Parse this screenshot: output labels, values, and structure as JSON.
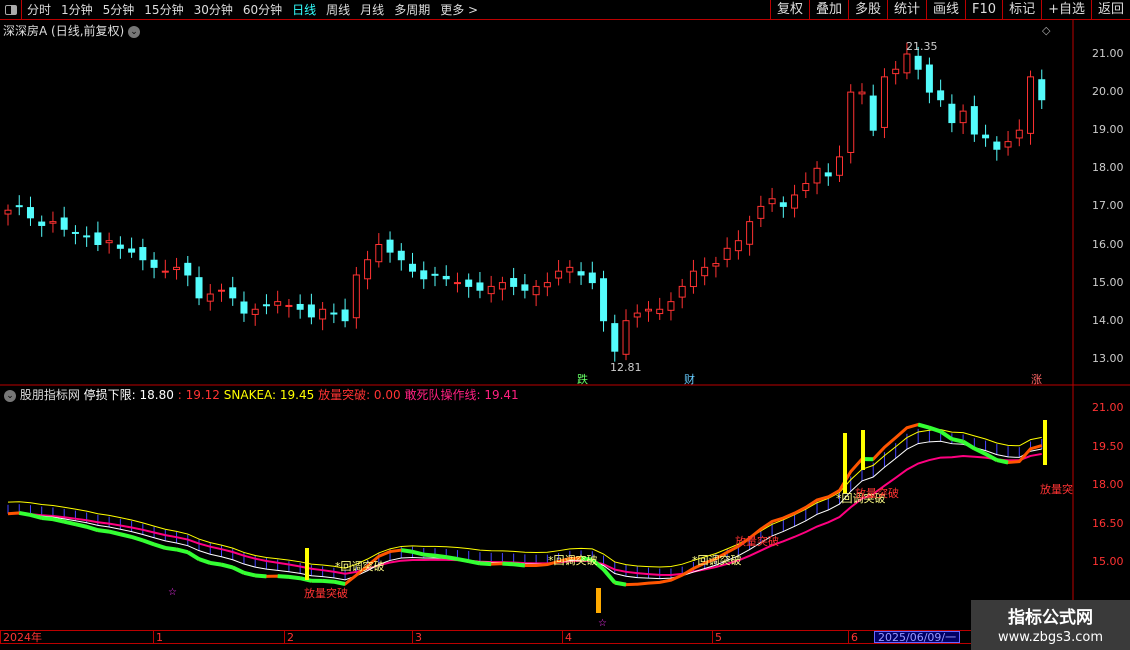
{
  "toolbar": {
    "periods": [
      "分时",
      "1分钟",
      "5分钟",
      "15分钟",
      "30分钟",
      "60分钟",
      "日线",
      "周线",
      "月线",
      "多周期",
      "更多 >"
    ],
    "active": "日线",
    "right_buttons": [
      "复权",
      "叠加",
      "多股",
      "统计",
      "画线",
      "F10",
      "标记",
      "+自选",
      "返回"
    ]
  },
  "main_title": "深深房A (日线,前复权)",
  "price_axis": [
    "21.00",
    "20.00",
    "19.00",
    "18.00",
    "17.00",
    "16.00",
    "15.00",
    "14.00",
    "13.00"
  ],
  "annotations": {
    "high": "21.35",
    "low": "12.81",
    "tag_die": "跌",
    "tag_cai": "财",
    "tag_zhang": "涨"
  },
  "indicator": {
    "name": "股朋指标网",
    "stop_label": "停损下限: 18.80",
    "v2": ": 19.12",
    "snake": "SNAKEA: 19.45",
    "vol_break": "放量突破: 0.00",
    "dare": "敢死队操作线: 19.41",
    "axis": [
      "21.00",
      "19.50",
      "18.00",
      "16.50",
      "15.00"
    ],
    "labels": {
      "huitiao": "*回调突破",
      "fangliang": "放量突破",
      "fangliang_cut": "放量突"
    }
  },
  "time_axis": {
    "year": "2024年",
    "months": [
      "1",
      "2",
      "3",
      "4",
      "5",
      "6"
    ],
    "cursor_date": "2025/06/09/一"
  },
  "watermark": {
    "title": "指标公式网",
    "url": "www.zbgs3.com"
  },
  "colors": {
    "up": "#ff3232",
    "down": "#54fcfc",
    "snake": "#ffff00",
    "dare": "#ff0080"
  },
  "chart_data": {
    "type": "candlestick",
    "closes": [
      16.9,
      17.0,
      16.7,
      16.5,
      16.6,
      16.4,
      16.3,
      16.2,
      16.0,
      16.1,
      15.9,
      15.8,
      15.6,
      15.4,
      15.3,
      15.4,
      15.2,
      14.6,
      14.7,
      14.8,
      14.6,
      14.2,
      14.3,
      14.4,
      14.5,
      14.4,
      14.3,
      14.1,
      14.3,
      14.2,
      14.0,
      15.2,
      15.6,
      16.0,
      15.8,
      15.6,
      15.3,
      15.1,
      15.2,
      15.1,
      15.0,
      14.9,
      14.8,
      14.9,
      15.0,
      14.9,
      14.8,
      14.9,
      15.0,
      15.3,
      15.4,
      15.2,
      15.0,
      14.0,
      13.2,
      14.0,
      14.2,
      14.3,
      14.3,
      14.5,
      14.9,
      15.3,
      15.4,
      15.5,
      15.9,
      16.1,
      16.6,
      17.0,
      17.2,
      17.0,
      17.3,
      17.6,
      18.0,
      17.8,
      18.3,
      20.0,
      20.0,
      19.0,
      20.4,
      20.6,
      21.0,
      20.6,
      20.0,
      19.8,
      19.2,
      19.5,
      18.9,
      18.8,
      18.5,
      18.7,
      19.0,
      20.4,
      19.8
    ],
    "ylim": [
      12.6,
      21.4
    ]
  }
}
